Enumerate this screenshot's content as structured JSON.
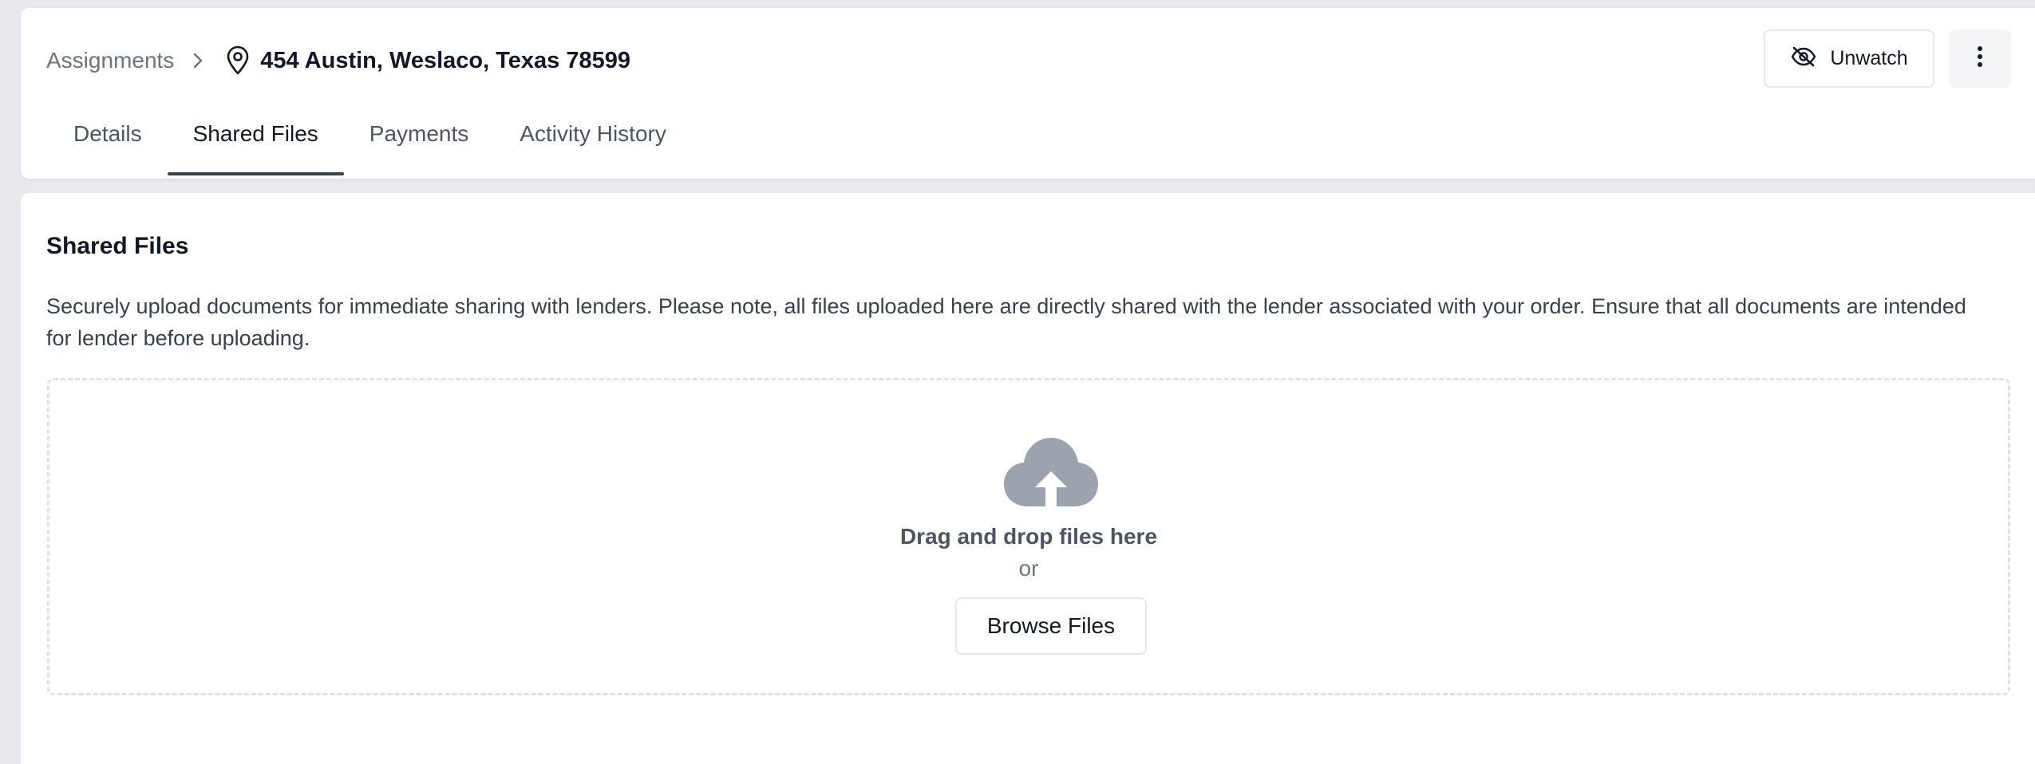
{
  "breadcrumb": {
    "parent": "Assignments",
    "chevron_icon": "chevron-right-icon",
    "location_icon": "map-pin-icon",
    "address": "454 Austin, Weslaco, Texas 78599"
  },
  "actions": {
    "unwatch_icon": "eye-off-icon",
    "unwatch_label": "Unwatch",
    "more_icon": "more-vertical-icon"
  },
  "tabs": [
    {
      "label": "Details",
      "active": false
    },
    {
      "label": "Shared Files",
      "active": true
    },
    {
      "label": "Payments",
      "active": false
    },
    {
      "label": "Activity History",
      "active": false
    }
  ],
  "shared_files": {
    "title": "Shared Files",
    "description": "Securely upload documents for immediate sharing with lenders. Please note, all files uploaded here are directly shared with the lender associated with your order. Ensure that all documents are intended for lender before uploading.",
    "upload_icon": "cloud-upload-icon",
    "drop_text": "Drag and drop files here",
    "or_text": "or",
    "browse_label": "Browse Files"
  },
  "colors": {
    "page_background": "#e8e9ed",
    "card_background": "#ffffff",
    "active_tab_underline": "#374151",
    "upload_icon": "#9ca3af",
    "dropzone_border": "#e0e1e4"
  }
}
